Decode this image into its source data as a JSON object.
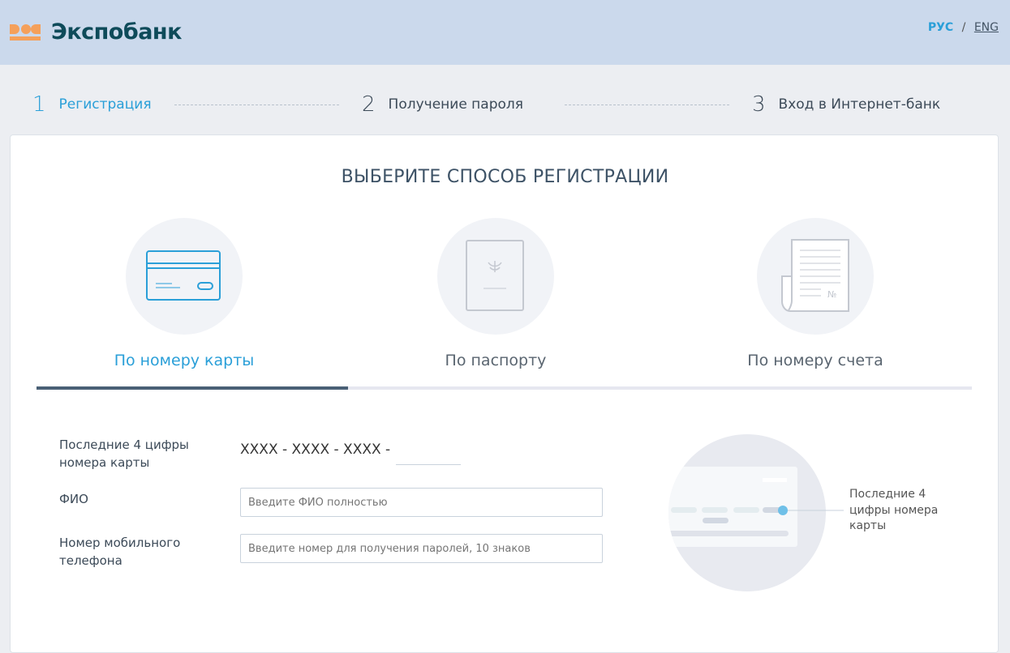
{
  "header": {
    "logo": "Экспобанк",
    "lang_ru": "РУС",
    "lang_sep": "/",
    "lang_en": "ENG"
  },
  "steps": [
    {
      "num": "1",
      "label": "Регистрация"
    },
    {
      "num": "2",
      "label": "Получение пароля"
    },
    {
      "num": "3",
      "label": "Вход в Интернет-банк"
    }
  ],
  "title": "ВЫБЕРИТЕ СПОСОБ РЕГИСТРАЦИИ",
  "tabs": [
    {
      "label": "По номеру карты"
    },
    {
      "label": "По паспорту"
    },
    {
      "label": "По номеру счета"
    }
  ],
  "form": {
    "card_label": "Последние 4 цифры номера карты",
    "card_mask": "XXXX - XXXX - XXXX -",
    "card_value": "",
    "fio_label": "ФИО",
    "fio_placeholder": "Введите ФИО полностью",
    "phone_label": "Номер мобильного телефона",
    "phone_placeholder": "Введите номер для получения паролей, 10 знаков"
  },
  "hint": "Последние 4 цифры номера карты",
  "colors": {
    "accent": "#2a9fd8",
    "header": "#cbd9ec",
    "logo": "#f5a05a"
  }
}
